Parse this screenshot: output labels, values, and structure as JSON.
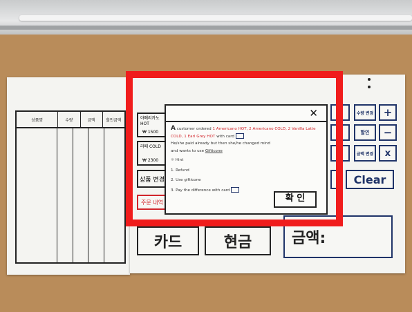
{
  "table": {
    "headers": [
      "상품명",
      "수량",
      "금액",
      "할인금액"
    ]
  },
  "menu": {
    "items": [
      {
        "title": "아메리카노 HOT",
        "price": "₩ 1500"
      },
      {
        "title": "라떼 COLD",
        "price": "₩ 2300"
      }
    ],
    "product_change": "상품 변경",
    "order_history": "주문 내역"
  },
  "keypad": {
    "qty_change": "수량 변경",
    "discount": "할인",
    "amount_change": "금액 변경",
    "plus": "+",
    "minus": "−",
    "times": "x",
    "clear": "Clear"
  },
  "payment": {
    "card": "카드",
    "cash": "현금",
    "amount": "금액:"
  },
  "dialog": {
    "close": "✕",
    "intro_a": "A",
    "intro_b": "customer ordered",
    "order_1": "1 Americano HOT, 2 Americano COLD,",
    "order_2": "2 Vanilla Latte COLD, 1 Earl Grey HOT",
    "with_card": "with card",
    "line_3": "He/she paid already but then she/he changed mind",
    "line_4": "and wants to use",
    "gifticon": "Gifticone",
    "hint": "Hint",
    "option_1": "1. Refund",
    "option_2": "2. Use gifticone",
    "option_3": "3. Pay the difference with card",
    "confirm": "확 인"
  },
  "colors": {
    "highlight": "#f01c1c",
    "accent_red": "#d1242a",
    "ink_blue": "#1f3368"
  }
}
